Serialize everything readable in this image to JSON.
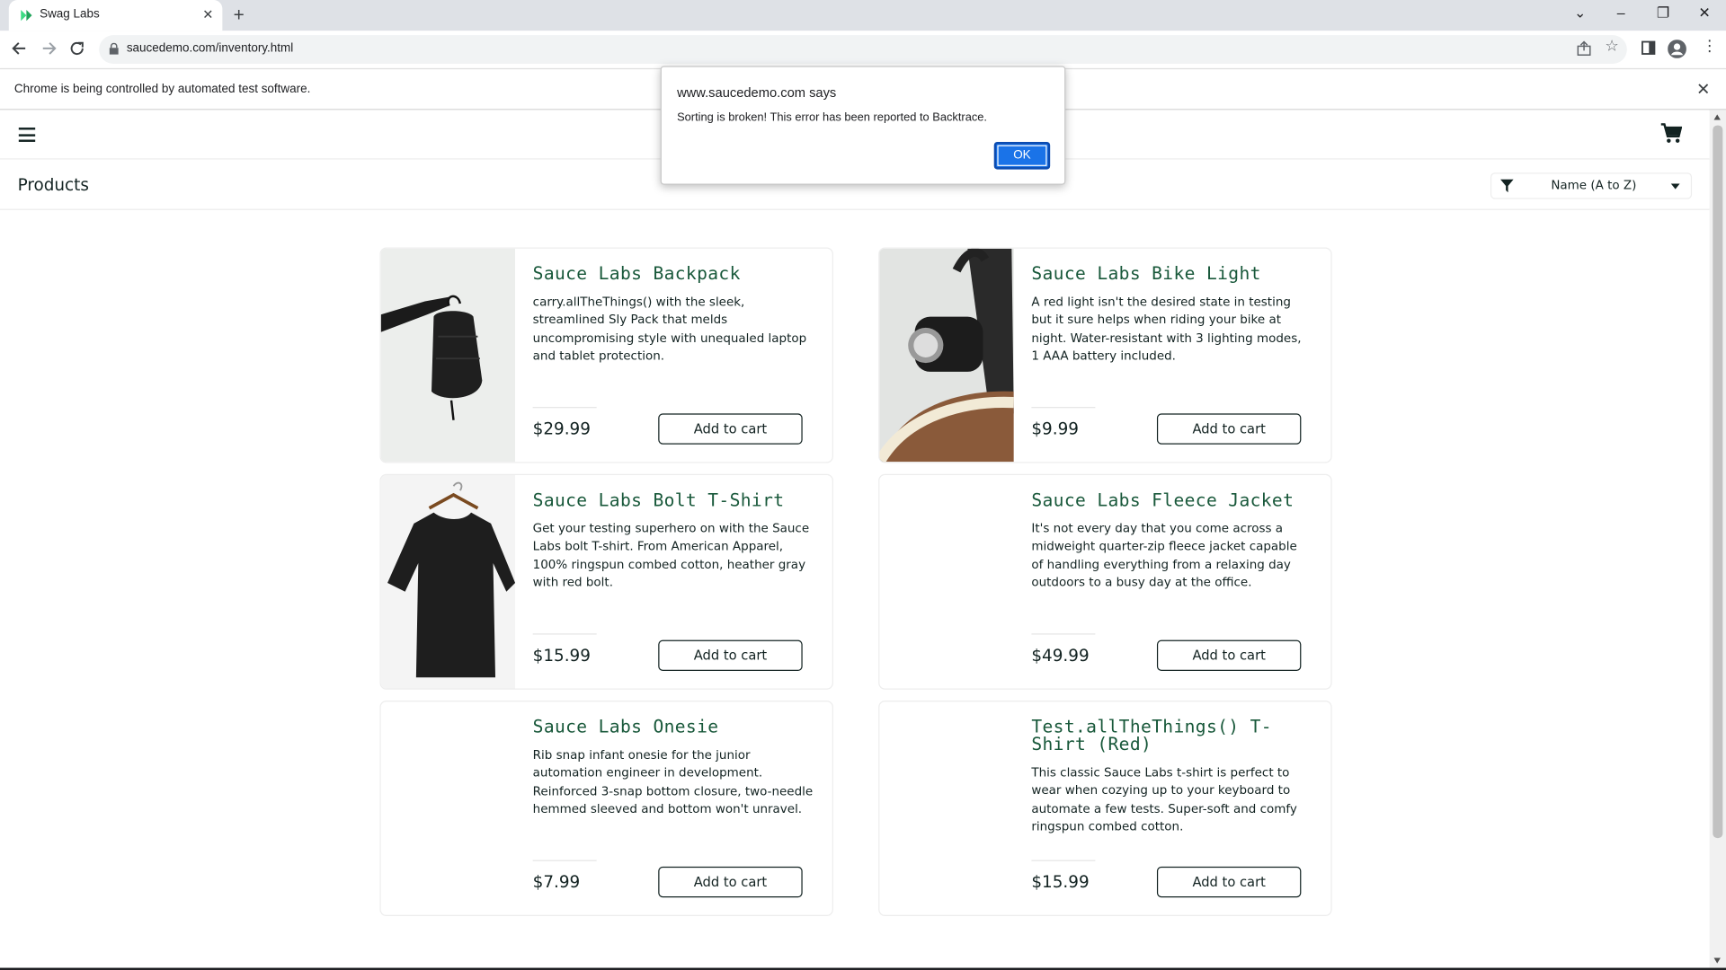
{
  "browser": {
    "tab_title": "Swag Labs",
    "tab_close": "✕",
    "new_tab": "+",
    "url": "saucedemo.com/inventory.html",
    "infobar_text": "Chrome is being controlled by automated test software.",
    "infobar_close": "✕",
    "window_controls": [
      "⌄",
      "–",
      "❐",
      "✕"
    ]
  },
  "page": {
    "title": "Products",
    "sort_selected": "Name (A to Z)"
  },
  "products": [
    {
      "name": "Sauce Labs Backpack",
      "description": "carry.allTheThings() with the sleek, streamlined Sly Pack that melds uncompromising style with unequaled laptop and tablet protection.",
      "price": "$29.99",
      "button": "Add to cart"
    },
    {
      "name": "Sauce Labs Bike Light",
      "description": "A red light isn't the desired state in testing but it sure helps when riding your bike at night. Water-resistant with 3 lighting modes, 1 AAA battery included.",
      "price": "$9.99",
      "button": "Add to cart"
    },
    {
      "name": "Sauce Labs Bolt T-Shirt",
      "description": "Get your testing superhero on with the Sauce Labs bolt T-shirt. From American Apparel, 100% ringspun combed cotton, heather gray with red bolt.",
      "price": "$15.99",
      "button": "Add to cart"
    },
    {
      "name": "Sauce Labs Fleece Jacket",
      "description": "It's not every day that you come across a midweight quarter-zip fleece jacket capable of handling everything from a relaxing day outdoors to a busy day at the office.",
      "price": "$49.99",
      "button": "Add to cart"
    },
    {
      "name": "Sauce Labs Onesie",
      "description": "Rib snap infant onesie for the junior automation engineer in development. Reinforced 3-snap bottom closure, two-needle hemmed sleeved and bottom won't unravel.",
      "price": "$7.99",
      "button": "Add to cart"
    },
    {
      "name": "Test.allTheThings() T-Shirt (Red)",
      "description": "This classic Sauce Labs t-shirt is perfect to wear when cozying up to your keyboard to automate a few tests. Super-soft and comfy ringspun combed cotton.",
      "price": "$15.99",
      "button": "Add to cart"
    }
  ],
  "dialog": {
    "title": "www.saucedemo.com says",
    "message": "Sorting is broken! This error has been reported to Backtrace.",
    "ok": "OK"
  },
  "colors": {
    "accent": "#1a73e8",
    "product_name": "#18583a",
    "text": "#132322"
  }
}
